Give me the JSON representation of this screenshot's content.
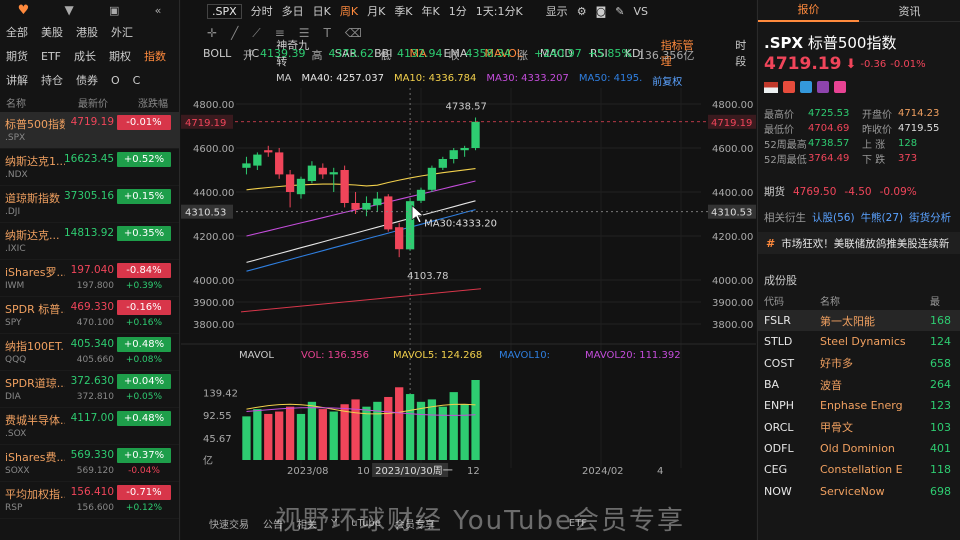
{
  "left": {
    "top_icons": [
      "heart-icon",
      "filter-icon",
      "delete-icon",
      "collapse-icon"
    ],
    "markets_row1": [
      "全部",
      "美股",
      "港股",
      "外汇"
    ],
    "markets_row2": [
      "期货",
      "ETF",
      "成长",
      "期权",
      "指数"
    ],
    "markets_row3": [
      "讲解",
      "持仓",
      "债券",
      "O",
      "C"
    ],
    "col_name": "名称",
    "col_price": "最新价",
    "col_change": "涨跌幅",
    "quotes": [
      {
        "name": "标普500指数",
        "sym": ".SPX",
        "price": "4719.19",
        "chg": "-0.01%",
        "dir": "dn",
        "sub": "",
        "chg2": ""
      },
      {
        "name": "纳斯达克1...",
        "sym": ".NDX",
        "price": "16623.45",
        "chg": "+0.52%",
        "dir": "up",
        "sub": "",
        "chg2": ""
      },
      {
        "name": "道琼斯指数",
        "sym": ".DJI",
        "price": "37305.16",
        "chg": "+0.15%",
        "dir": "up",
        "sub": "",
        "chg2": ""
      },
      {
        "name": "纳斯达克...",
        "sym": ".IXIC",
        "price": "14813.92",
        "chg": "+0.35%",
        "dir": "up",
        "sub": "",
        "chg2": ""
      },
      {
        "name": "iShares罗...",
        "sym": "IWM",
        "price": "197.040",
        "chg": "-0.84%",
        "dir": "dn",
        "sub": "197.800",
        "chg2": "+0.39%"
      },
      {
        "name": "SPDR 标普...",
        "sym": "SPY",
        "price": "469.330",
        "chg": "-0.16%",
        "dir": "dn",
        "sub": "470.100",
        "chg2": "+0.16%"
      },
      {
        "name": "纳指100ET...",
        "sym": "QQQ",
        "price": "405.340",
        "chg": "+0.48%",
        "dir": "up",
        "sub": "405.660",
        "chg2": "+0.08%"
      },
      {
        "name": "SPDR道琼...",
        "sym": "DIA",
        "price": "372.630",
        "chg": "+0.04%",
        "dir": "up",
        "sub": "372.810",
        "chg2": "+0.05%"
      },
      {
        "name": "费城半导体...",
        "sym": ".SOX",
        "price": "4117.00",
        "chg": "+0.48%",
        "dir": "up",
        "sub": "",
        "chg2": ""
      },
      {
        "name": "iShares费...",
        "sym": "SOXX",
        "price": "569.330",
        "chg": "+0.37%",
        "dir": "up",
        "sub": "569.120",
        "chg2": "-0.04%"
      },
      {
        "name": "平均加权指...",
        "sym": "RSP",
        "price": "156.410",
        "chg": "-0.71%",
        "dir": "dn",
        "sub": "156.600",
        "chg2": "+0.12%"
      }
    ]
  },
  "center": {
    "symbol": ".SPX",
    "periods": [
      "分时",
      "多日",
      "日K",
      "周K",
      "月K",
      "季K",
      "年K",
      "1分",
      "1天",
      "1分K"
    ],
    "period_active": "周K",
    "display_label": "显示",
    "vs_label": "VS",
    "ohlc": {
      "open_label": "开",
      "open": "4139.39",
      "high_label": "高",
      "high": "4373.62",
      "low_label": "低",
      "low": "4132.94",
      "close_label": "收",
      "close": "4358.34",
      "chg_label": "涨",
      "chg": "+240.97",
      "pct": "+5.85%",
      "vol": "136.356亿"
    },
    "ma_label": "MA",
    "ma_values": [
      {
        "label": "MA40: 4257.037",
        "color": "#e6e6e6"
      },
      {
        "label": "MA10: 4336.784",
        "color": "#f2d04c"
      },
      {
        "label": "MA30: 4333.207",
        "color": "#c44ddb"
      },
      {
        "label": "MA50: 4195.",
        "color": "#2f7fe0"
      }
    ],
    "fq_label": "前复权",
    "price_axis": [
      "4800.00",
      "4600.00",
      "4400.00",
      "4200.00",
      "4000.00",
      "3900.00",
      "3800.00"
    ],
    "last_price_tag": "4719.19",
    "cross_price_tag": "4310.53",
    "high_annot": "4738.57",
    "low_annot": "4103.78",
    "ma30_annot": "MA30:4333.20",
    "vol_legend": {
      "label": "MAVOL",
      "vol": "VOL: 136.356",
      "ma5": "MAVOL5: 124.268",
      "ma10": "MAVOL10:",
      "ma20": "MAVOL20: 111.392"
    },
    "vol_axis": [
      "139.42",
      "92.55",
      "45.67",
      "亿"
    ],
    "date_axis": [
      "2023/08",
      "10",
      "12",
      "2024/02",
      "4"
    ],
    "cross_date": "2023/10/30周一",
    "indicators": [
      "BOLL",
      "IC",
      "神奇九转",
      "SAR",
      "BBI",
      "MA",
      "EMA",
      "MAVOL",
      "MACD",
      "RSI",
      "KDJ",
      "指标管理",
      "时段"
    ],
    "indicators_active": [
      "MA",
      "MAVOL",
      "指标管理"
    ],
    "bottom_items": [
      "快速交易",
      "公告",
      "相关",
      "Y",
      "uTube",
      "会员专享",
      "ETF"
    ],
    "watermark": "视野环球财经 YouTube会员专享"
  },
  "right": {
    "tab_quote": "报价",
    "tab_news": "资讯",
    "symbol": ".SPX",
    "name": "标普500指数",
    "price": "4719.19",
    "chg": "-0.36",
    "pct": "-0.01%",
    "stats": [
      {
        "k": "最高价",
        "v": "4725.53",
        "k2": "开盘价",
        "v2": "4714.23"
      },
      {
        "k": "最低价",
        "v": "4704.69",
        "k2": "昨收价",
        "v2": "4719.55"
      },
      {
        "k": "52周最高",
        "v": "4738.57",
        "k2": "上 涨",
        "v2": "128"
      },
      {
        "k": "52周最低",
        "v": "3764.49",
        "k2": "下 跌",
        "v2": "373"
      }
    ],
    "futures_label": "期货",
    "futures_price": "4769.50",
    "futures_chg": "-4.50",
    "futures_pct": "-0.09%",
    "related_label": "相关衍生",
    "option1": "认股(56)",
    "option2": "牛熊(27)",
    "option3": "街货分析",
    "news": "市场狂欢！美联储放鸽推美股连续新",
    "constituents_title": "成份股",
    "cp_code": "代码",
    "cp_name": "名称",
    "cp_latest": "最",
    "constituents": [
      {
        "s": "FSLR",
        "n": "第一太阳能",
        "v": "168"
      },
      {
        "s": "STLD",
        "n": "Steel Dynamics",
        "v": "124"
      },
      {
        "s": "COST",
        "n": "好市多",
        "v": "658"
      },
      {
        "s": "BA",
        "n": "波音",
        "v": "264"
      },
      {
        "s": "ENPH",
        "n": "Enphase Energ",
        "v": "123"
      },
      {
        "s": "ORCL",
        "n": "甲骨文",
        "v": "103"
      },
      {
        "s": "ODFL",
        "n": "Old Dominion",
        "v": "401"
      },
      {
        "s": "CEG",
        "n": "Constellation E",
        "v": "118"
      },
      {
        "s": "NOW",
        "n": "ServiceNow",
        "v": "698"
      }
    ]
  },
  "chart_data": {
    "type": "candlestick",
    "title": ".SPX",
    "period": "周K",
    "x_axis_labels": [
      "2023/08",
      "10",
      "12",
      "2024/02",
      "4"
    ],
    "ylim": [
      3800,
      4800
    ],
    "candles": [
      {
        "o": 4510,
        "h": 4560,
        "l": 4480,
        "c": 4530
      },
      {
        "o": 4520,
        "h": 4580,
        "l": 4500,
        "c": 4570
      },
      {
        "o": 4590,
        "h": 4610,
        "l": 4560,
        "c": 4580
      },
      {
        "o": 4580,
        "h": 4600,
        "l": 4460,
        "c": 4480
      },
      {
        "o": 4480,
        "h": 4500,
        "l": 4330,
        "c": 4400
      },
      {
        "o": 4390,
        "h": 4470,
        "l": 4370,
        "c": 4460
      },
      {
        "o": 4450,
        "h": 4540,
        "l": 4440,
        "c": 4520
      },
      {
        "o": 4510,
        "h": 4530,
        "l": 4460,
        "c": 4480
      },
      {
        "o": 4480,
        "h": 4510,
        "l": 4400,
        "c": 4490
      },
      {
        "o": 4500,
        "h": 4520,
        "l": 4330,
        "c": 4350
      },
      {
        "o": 4350,
        "h": 4400,
        "l": 4300,
        "c": 4320
      },
      {
        "o": 4320,
        "h": 4380,
        "l": 4290,
        "c": 4350
      },
      {
        "o": 4340,
        "h": 4400,
        "l": 4310,
        "c": 4370
      },
      {
        "o": 4380,
        "h": 4390,
        "l": 4220,
        "c": 4230
      },
      {
        "o": 4240,
        "h": 4260,
        "l": 4103.78,
        "c": 4140
      },
      {
        "o": 4139.39,
        "h": 4373.62,
        "l": 4132.94,
        "c": 4358.34
      },
      {
        "o": 4360,
        "h": 4420,
        "l": 4350,
        "c": 4410
      },
      {
        "o": 4410,
        "h": 4520,
        "l": 4400,
        "c": 4510
      },
      {
        "o": 4510,
        "h": 4560,
        "l": 4500,
        "c": 4550
      },
      {
        "o": 4550,
        "h": 4600,
        "l": 4530,
        "c": 4590
      },
      {
        "o": 4590,
        "h": 4610,
        "l": 4560,
        "c": 4600
      },
      {
        "o": 4600,
        "h": 4738.57,
        "l": 4590,
        "c": 4719.19
      }
    ],
    "volume": [
      90,
      105,
      95,
      100,
      110,
      95,
      120,
      105,
      100,
      115,
      125,
      110,
      120,
      130,
      150,
      136,
      120,
      125,
      110,
      140,
      115,
      165
    ],
    "vol_ylim": [
      0,
      165
    ],
    "ma_series": [
      {
        "name": "MA40",
        "color": "#e6e6e6",
        "start": 4080,
        "end": 4360
      },
      {
        "name": "MA10",
        "color": "#f2d04c",
        "start": 4410,
        "end": 4520
      },
      {
        "name": "MA30",
        "color": "#c44ddb",
        "start": 4200,
        "end": 4450
      },
      {
        "name": "MA50",
        "color": "#2f7fe0",
        "start": 4040,
        "end": 4320
      }
    ]
  }
}
